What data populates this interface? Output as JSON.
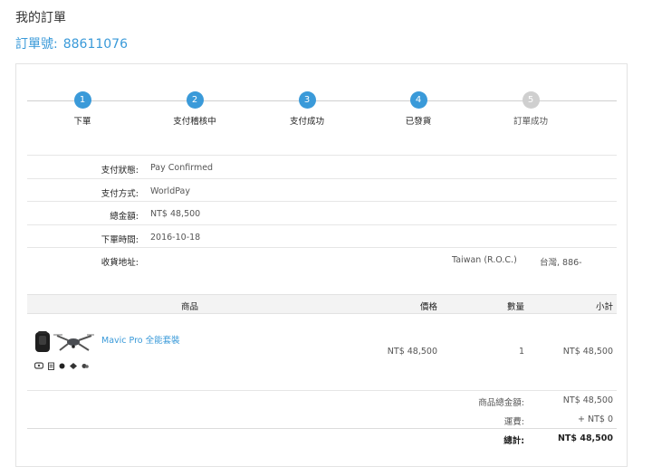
{
  "page_title": "我的訂單",
  "order": {
    "label": "訂單號:",
    "number": "88611076"
  },
  "steps": [
    {
      "num": "1",
      "label": "下單",
      "active": true
    },
    {
      "num": "2",
      "label": "支付稽核中",
      "active": true
    },
    {
      "num": "3",
      "label": "支付成功",
      "active": true
    },
    {
      "num": "4",
      "label": "已發貨",
      "active": true
    },
    {
      "num": "5",
      "label": "訂單成功",
      "active": false
    }
  ],
  "info": {
    "payment_status": {
      "label": "支付狀態:",
      "value": "Pay Confirmed"
    },
    "payment_method": {
      "label": "支付方式:",
      "value": "WorldPay"
    },
    "total_amount": {
      "label": "總金額:",
      "value": "NT$ 48,500"
    },
    "order_time": {
      "label": "下單時間:",
      "value": "2016-10-18"
    },
    "shipping_address": {
      "label": "收貨地址:",
      "country": "Taiwan (R.O.C.)",
      "region": "台灣, 886-"
    }
  },
  "products": {
    "headers": {
      "product": "商品",
      "price": "價格",
      "quantity": "數量",
      "subtotal": "小計"
    },
    "items": [
      {
        "name": "Mavic Pro 全能套裝",
        "price": "NT$ 48,500",
        "quantity": "1",
        "subtotal": "NT$ 48,500"
      }
    ]
  },
  "summary": {
    "goods_total": {
      "label": "商品總金額:",
      "value": "NT$ 48,500"
    },
    "shipping": {
      "label": "運費:",
      "value": "+ NT$ 0"
    },
    "grand_total": {
      "label": "總計:",
      "value": "NT$ 48,500"
    }
  },
  "colors": {
    "accent": "#3a9ad9",
    "inactive": "#cfcfcf"
  },
  "icons": [
    "backpack-icon",
    "drone-icon",
    "controller-icon",
    "battery-icon",
    "propeller-icon",
    "charger-icon",
    "gimbal-cover-icon"
  ]
}
